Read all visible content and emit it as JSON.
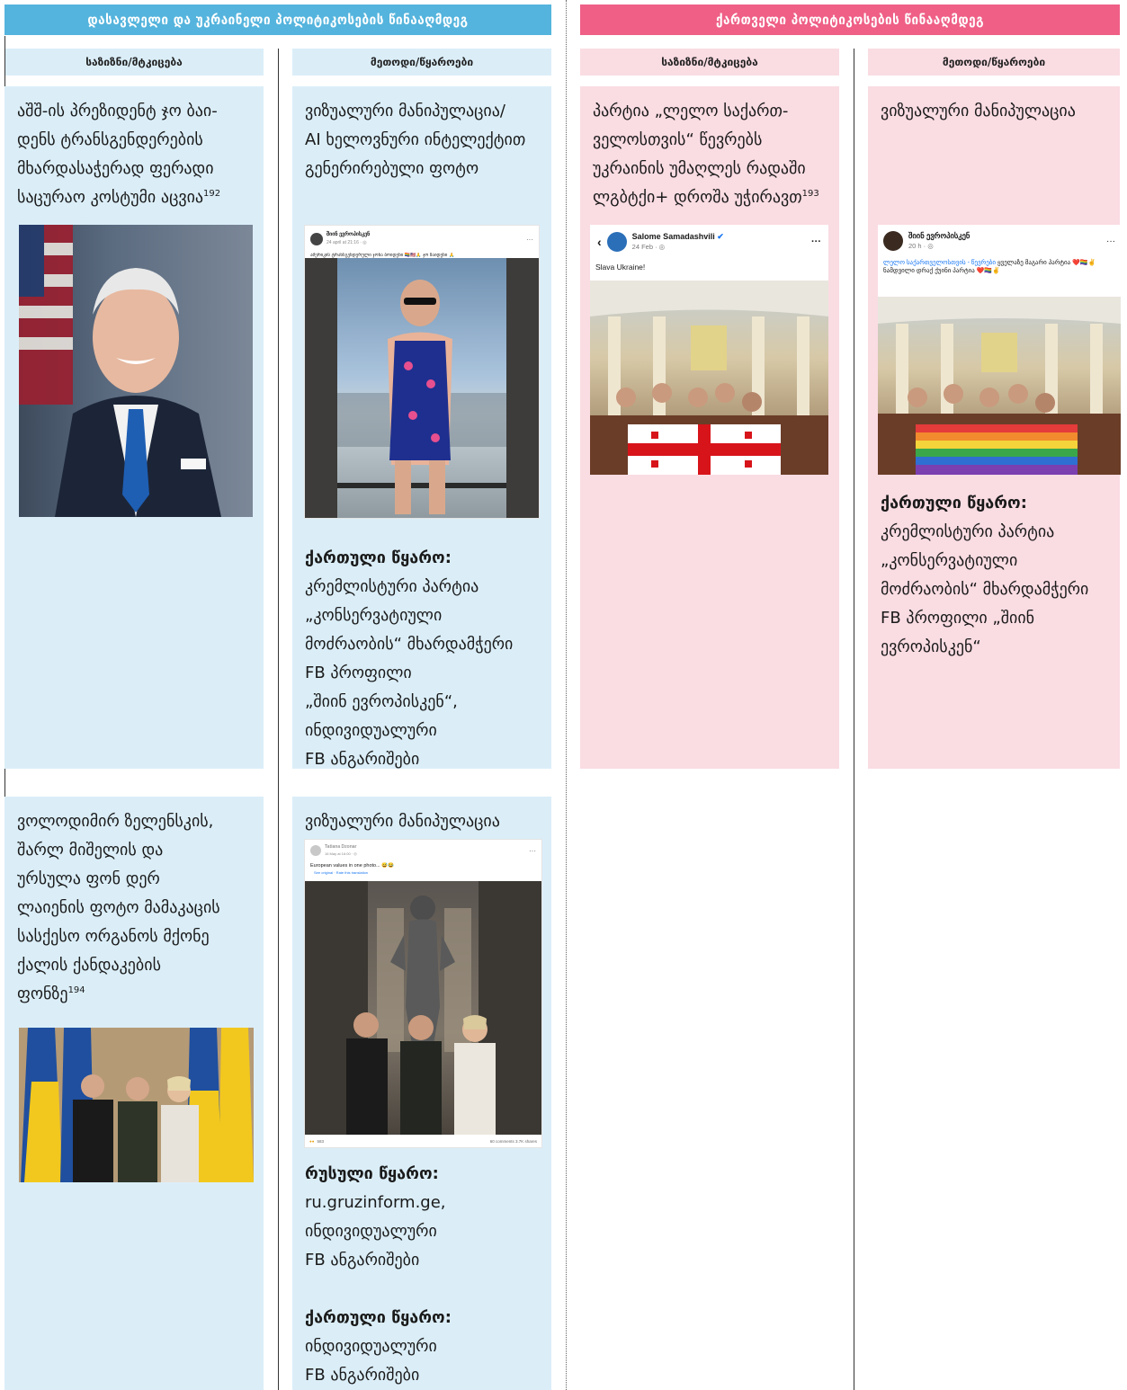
{
  "headers": {
    "left_banner": "დასავლელი და უკრაინელი პოლიტიკოსების წინააღმდეგ",
    "right_banner": "ქართველი პოლიტიკოსების წინააღმდეგ",
    "col_message": "საზიზნი/მტკიცება",
    "col_method": "მეთოდი/წყაროები"
  },
  "colors": {
    "blue_banner": "#54b4dd",
    "pink_banner": "#ef5f86",
    "blue_cell": "#dbeef8",
    "pink_cell": "#fadce3"
  },
  "left": {
    "row1": {
      "message": "აშშ-ის პრეზიდენტ ჯო ბაი-\nდენს ტრანსგენდერების\nმხარდასაჭერად ფერადი\nსაცურაო კოსტუმი აცვია",
      "footnote": "192",
      "method": "ვიზუალური მანიპულაცია/\nAI ხელოვნური ინტელექტით\nგენერირებული ფოტო",
      "source_label": "ქართული წყარო:",
      "source_text": "კრემლისტური პარტია\n„კონსერვატიული\nმოძრაობის“ მხარდამჭერი\nFB პროფილი\n„შიინ ევროპისკენ“,\nინდივიდუალური\nFB ანგარიშები",
      "post_name": "შიინ ევროპისკენ",
      "post_date": "24 april at 21:16 · ◎",
      "post_text": "ამერიკის ტრანსგენდერული ჯონა ბოიდენი 🏳️‍🌈🇺🇸🙏 ჯო ზაიდენი 🙏"
    },
    "row2": {
      "message": "ვოლოდიმირ ზელენსკის,\nშარლ მიშელის და\nურსულა ფონ დერ\nლაიენის ფოტო მამაკაცის\nსასქესო ორგანოს მქონე\nქალის ქანდაკების\nფონზე",
      "footnote": "194",
      "method": "ვიზუალური მანიპულაცია",
      "source1_label": "რუსული წყარო:",
      "source1_text": "ru.gruzinform.ge,\nინდივიდუალური\nFB ანგარიშები",
      "source2_label": "ქართული წყარო:",
      "source2_text": "ინდივიდუალური\nFB ანგარიშები",
      "post_name": "Tatiana Dzonar",
      "post_date": "16 May at 16:00 · ◎",
      "post_text": "European values in one photo... 😅😂",
      "post_translate": "See original · Rate this translation",
      "post_reactions": "583",
      "post_stats": "60 comments  3.7K shares"
    }
  },
  "right": {
    "row1": {
      "message": "პარტია „ლელო საქართ-\nველოსთვის“ წევრებს\nუკრაინის უმაღლეს რადაში\nლგბტქი+ დროშა უჭირავთ",
      "footnote": "193",
      "method": "ვიზუალური მანიპულაცია",
      "source_label": "ქართული წყარო:",
      "source_text": "კრემლისტური პარტია\n„კონსერვატიული\nმოძრაობის“ მხარდამჭერი\nFB პროფილი „შიინ\nევროპისკენ“",
      "orig_post_name": "Salome Samadashvili",
      "orig_post_date": "24 Feb · ◎",
      "orig_post_text": "Slava Ukraine!",
      "fake_post_name": "შიინ ევროპისკენ",
      "fake_post_date": "20 h · ◎",
      "fake_post_text_link": "ლელო საქართველოსთვის - წევრები",
      "fake_post_text": " ყველაზე მაგარი პარტია ❤️🏳️‍🌈✌️ ნამდვილი დრაქ ქუინი პარტია ❤️🏳️‍🌈✌️"
    }
  }
}
